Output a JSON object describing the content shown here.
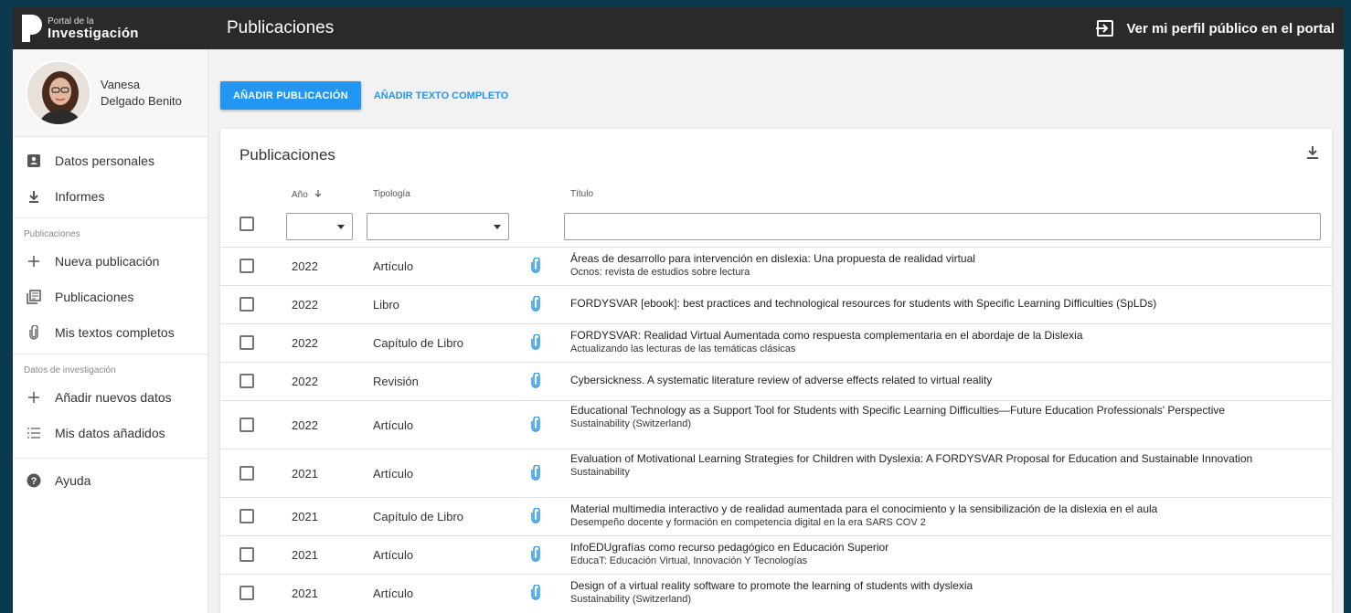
{
  "header": {
    "logo_small": "Portal de la",
    "logo_big": "Investigación",
    "page_title": "Publicaciones",
    "profile_link": "Ver mi perfil público en el portal"
  },
  "user": {
    "first_name": "Vanesa",
    "last_name": "Delgado Benito"
  },
  "sidebar": {
    "items": [
      {
        "label": "Datos personales",
        "icon": "id-card-icon"
      },
      {
        "label": "Informes",
        "icon": "download-icon"
      }
    ],
    "section_publicaciones": "Publicaciones",
    "pub_items": [
      {
        "label": "Nueva publicación",
        "icon": "plus-icon"
      },
      {
        "label": "Publicaciones",
        "icon": "library-icon"
      },
      {
        "label": "Mis textos completos",
        "icon": "paperclip-icon"
      }
    ],
    "section_datos": "Datos de investigación",
    "data_items": [
      {
        "label": "Añadir nuevos datos",
        "icon": "plus-icon"
      },
      {
        "label": "Mis datos añadidos",
        "icon": "list-icon"
      }
    ],
    "help": {
      "label": "Ayuda",
      "icon": "help-circle-icon"
    }
  },
  "toolbar": {
    "add_publication": "AÑADIR PUBLICACIÓN",
    "add_fulltext": "AÑADIR TEXTO COMPLETO"
  },
  "table": {
    "title": "Publicaciones",
    "columns": {
      "year": "Año",
      "type": "Tipología",
      "title": "Título"
    },
    "rows": [
      {
        "year": "2022",
        "type": "Artículo",
        "title": "Áreas de desarrollo para intervención en dislexia: Una propuesta de realidad virtual",
        "source": "Ocnos: revista de estudios sobre lectura"
      },
      {
        "year": "2022",
        "type": "Libro",
        "title": "FORDYSVAR [ebook]: best practices and technological resources for students with Specific Learning Difficulties (SpLDs)",
        "source": ""
      },
      {
        "year": "2022",
        "type": "Capítulo de Libro",
        "title": "FORDYSVAR: Realidad Virtual Aumentada como respuesta complementaria en el abordaje de la Dislexia",
        "source": "Actualizando las lecturas de las temáticas clásicas"
      },
      {
        "year": "2022",
        "type": "Revisión",
        "title": "Cybersickness. A systematic literature review of adverse effects related to virtual reality",
        "source": ""
      },
      {
        "year": "2022",
        "type": "Artículo",
        "title": "Educational Technology as a Support Tool for Students with Specific Learning Difficulties—Future Education Professionals' Perspective",
        "source": "Sustainability (Switzerland)"
      },
      {
        "year": "2021",
        "type": "Artículo",
        "title": "Evaluation of Motivational Learning Strategies for Children with Dyslexia: A FORDYSVAR Proposal for Education and Sustainable Innovation",
        "source": "Sustainability"
      },
      {
        "year": "2021",
        "type": "Capítulo de Libro",
        "title": "Material multimedia interactivo y de realidad aumentada para el conocimiento y la sensibilización de la dislexia en el aula",
        "source": "Desempeño docente y formación en competencia digital en la era SARS COV 2"
      },
      {
        "year": "2021",
        "type": "Artículo",
        "title": "InfoEDUgrafías como recurso pedagógico en Educación Superior",
        "source": "EducaT: Educación Virtual, Innovación Y Tecnologías"
      },
      {
        "year": "2021",
        "type": "Artículo",
        "title": "Design of a virtual reality software to promote the learning of students with dyslexia",
        "source": "Sustainability (Switzerland)"
      }
    ]
  },
  "colors": {
    "primary": "#2196f3",
    "topbar": "#2a2a2a",
    "outer_bg": "#0b3a4f"
  }
}
